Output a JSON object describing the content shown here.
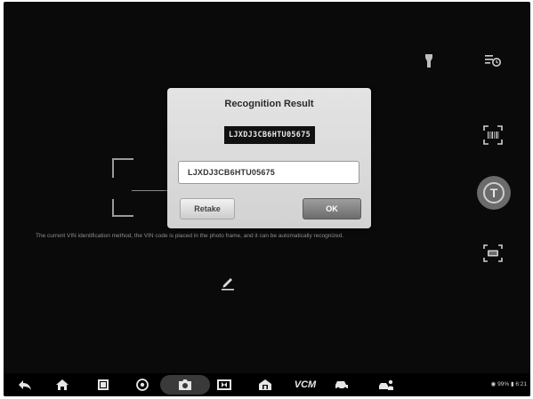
{
  "camera": {
    "hint": "The current VIN identification method, the VIN code is placed in the photo frame, and it can be automatically recognized."
  },
  "tools": {
    "text_mode_label": "T"
  },
  "dialog": {
    "title": "Recognition Result",
    "captured_vin": "LJXDJ3CB6HTU05675",
    "vin_value": "LJXDJ3CB6HTU05675",
    "retake_label": "Retake",
    "ok_label": "OK"
  },
  "navbar": {
    "vcm_label": "VCM",
    "status": "◉ 99% ▮ 6:21"
  },
  "colors": {
    "background": "#0a0a0a",
    "dialog": "#dcdcdc",
    "ok_button": "#7a7a7a"
  }
}
